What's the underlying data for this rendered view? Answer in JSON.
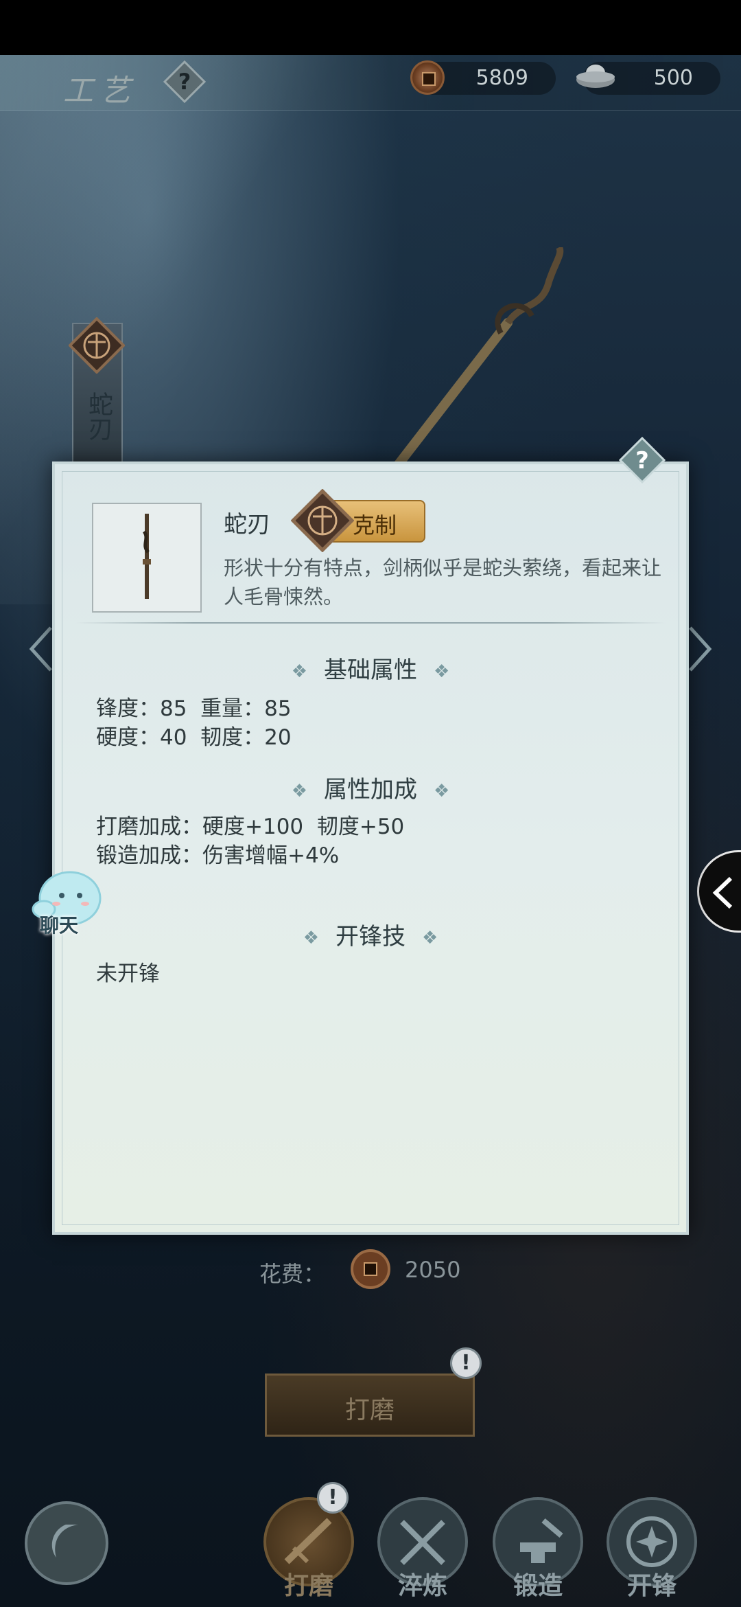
{
  "header": {
    "title": "工艺",
    "coins": "5809",
    "silver": "500"
  },
  "left_banner": {
    "text": "蛇刃"
  },
  "chat": {
    "label": "聊天"
  },
  "item": {
    "name": "蛇刃",
    "tag": "克制",
    "description": "形状十分有特点，剑柄似乎是蛇头萦绕，看起来让人毛骨悚然。"
  },
  "sections": {
    "base": {
      "title": "基础属性",
      "line1": "锋度：85  重量：85",
      "line2": "硬度：40  韧度：20"
    },
    "bonus": {
      "title": "属性加成",
      "line1": "打磨加成：硬度+100  韧度+50",
      "line2": "锻造加成：伤害增幅+4%"
    },
    "edge": {
      "title": "开锋技",
      "line1": "未开锋"
    }
  },
  "cost": {
    "label": "花费：",
    "value": "2050"
  },
  "action": {
    "label": "打磨"
  },
  "bottom_nav": {
    "items": [
      {
        "label": "打磨"
      },
      {
        "label": "淬炼"
      },
      {
        "label": "锻造"
      },
      {
        "label": "开锋"
      }
    ]
  },
  "colors": {
    "panel_bg": "#dfeaea",
    "badge_gold": "#d9ad5e"
  }
}
